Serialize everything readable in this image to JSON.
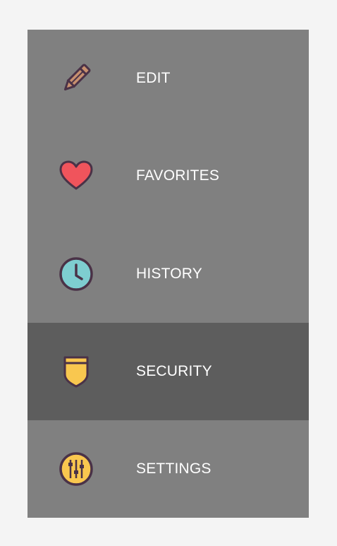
{
  "menu": {
    "items": [
      {
        "label": "EDIT",
        "icon": "pencil-icon",
        "active": false
      },
      {
        "label": "FAVORITES",
        "icon": "heart-icon",
        "active": false
      },
      {
        "label": "HISTORY",
        "icon": "clock-icon",
        "active": false
      },
      {
        "label": "SECURITY",
        "icon": "shield-icon",
        "active": true
      },
      {
        "label": "SETTINGS",
        "icon": "sliders-icon",
        "active": false
      }
    ]
  },
  "colors": {
    "page_background": "#f4f4f4",
    "menu_background": "#808080",
    "active_background": "#5d5d5d",
    "label_text": "#ffffff",
    "icon_outline": "#4a3247",
    "pencil_body": "#c7906f",
    "heart_fill": "#f0545c",
    "clock_fill": "#7ecdd0",
    "shield_fill": "#f9c74f",
    "settings_fill": "#f9c74f"
  }
}
